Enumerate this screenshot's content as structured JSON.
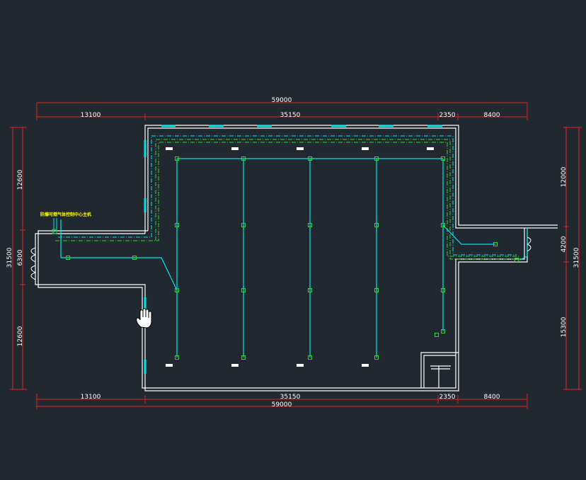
{
  "drawing": {
    "overall_width_top": "59000",
    "overall_width_bottom": "59000",
    "top_segments": [
      "13100",
      "35150",
      "2350",
      "8400"
    ],
    "bottom_segments": [
      "13100",
      "35150",
      "2350",
      "8400"
    ],
    "left_segments": [
      "12600",
      "6300",
      "12600"
    ],
    "left_total": "31500",
    "right_segments": [
      "12000",
      "4200",
      "15300"
    ],
    "right_total": "31500",
    "host_label": "防爆可燃气体控制中心主机"
  },
  "colors": {
    "background": "#212830",
    "wall": "#ffffff",
    "dimension": "#e32020",
    "cable": "#00e5e5",
    "detector": "#35d035",
    "label": "#ffff00"
  },
  "icons": {
    "cursor": "hand-cursor-icon"
  }
}
